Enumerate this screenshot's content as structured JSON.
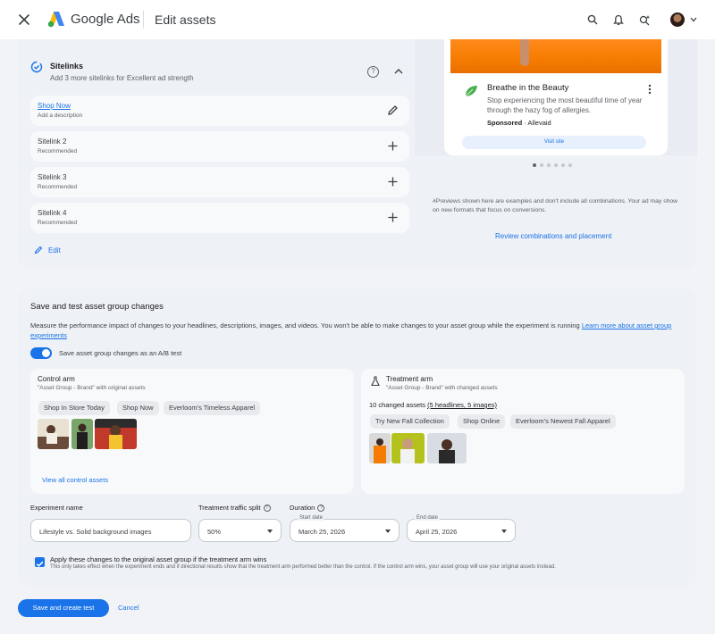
{
  "app": {
    "brand_name": "Google Ads",
    "page_title": "Edit assets"
  },
  "topbar": {
    "icons": [
      "close-icon",
      "search-icon",
      "bell-icon",
      "sparkle-search-icon",
      "avatar",
      "chevron-down-icon"
    ]
  },
  "sitelinks": {
    "title": "Sitelinks",
    "subtitle": "Add 3 more sitelinks for Excellent ad strength",
    "items": [
      {
        "name": "Shop Now",
        "sub": "Add a description",
        "action": "edit"
      },
      {
        "name": "Sitelink 2",
        "sub": "Recommended",
        "action": "add"
      },
      {
        "name": "Sitelink 3",
        "sub": "Recommended",
        "action": "add"
      },
      {
        "name": "Sitelink 4",
        "sub": "Recommended",
        "action": "add"
      }
    ],
    "edit_label": "Edit"
  },
  "preview": {
    "ad_title": "Breathe in the Beauty",
    "ad_description": "Stop experiencing the most beautiful time of year through the hazy fog of allergies.",
    "sponsored_label": "Sponsored",
    "advertiser": "· Allevaid",
    "visit_button": "Visit site",
    "carousel": {
      "total": 6,
      "active": 1
    },
    "disclaimer": "#Previews shown here are examples and don't include all combinations. Your ad may show on new formats that focus on conversions.",
    "review_link": "Review combinations and placement"
  },
  "save_test": {
    "title": "Save and test asset group changes",
    "description": "Measure the performance impact of changes to your headlines, descriptions, images, and videos. You won't be able to make changes to your asset group while the experiment is running",
    "learn_more": "Learn more about asset group experiments",
    "toggle_label": "Save asset group changes as an A/B test",
    "toggle_on": true
  },
  "control_arm": {
    "title": "Control arm",
    "subtitle": "\"Asset Group - Brand\" with original assets",
    "chips": [
      "Shop In Store Today",
      "Shop Now",
      "Everloom's Timeless Apparel"
    ],
    "view_link": "View all control assets"
  },
  "treatment_arm": {
    "title": "Treatment arm",
    "subtitle": "\"Asset Group - Brand\" with changed assets",
    "changed_summary": "10 changed assets",
    "changed_breakdown": "(5 headlines, 5 images)",
    "chips": [
      "Try New Fall Collection",
      "Shop Online",
      "Everloom's Newest Fall Apparel"
    ]
  },
  "experiment": {
    "name_label": "Experiment name",
    "name_value": "Lifestyle vs. Solid background images",
    "split_label": "Treatment traffic split",
    "split_value": "50%",
    "duration_label": "Duration",
    "start_label": "Start date",
    "start_value": "March 25, 2026",
    "end_label": "End date",
    "end_value": "April 25, 2026"
  },
  "apply": {
    "checked": true,
    "label": "Apply these changes to the original asset group if the treatment arm wins",
    "note": "This only takes effect when the experiment ends and if directional results show that the treatment arm performed better than the control. If the control arm wins, your asset group will use your original assets instead."
  },
  "footer": {
    "primary": "Save and create test",
    "cancel": "Cancel"
  },
  "colors": {
    "accent": "#1a73e8",
    "page_bg": "#f1f3f6",
    "card_bg": "#eef1f6"
  }
}
